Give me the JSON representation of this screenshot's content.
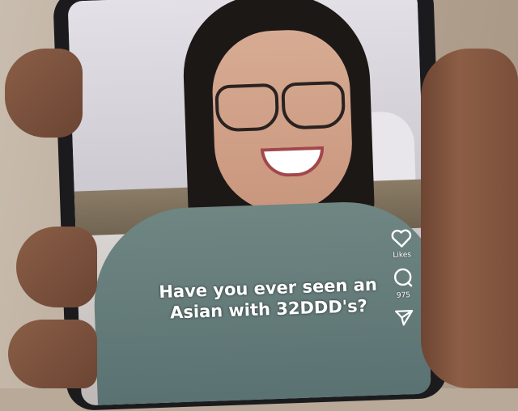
{
  "post": {
    "caption": "Have you ever seen an Asian with 32DDD's?"
  },
  "actions": {
    "like_label": "Likes",
    "comment_count": "975"
  }
}
